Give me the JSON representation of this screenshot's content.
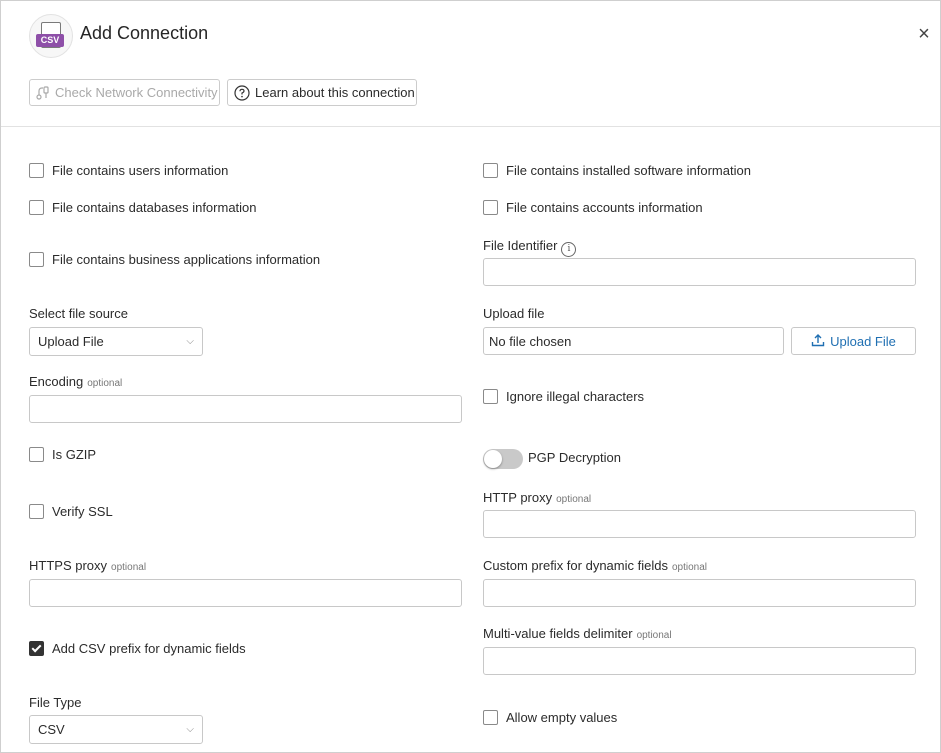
{
  "dialog": {
    "title": "Add Connection",
    "logo_text": "CSV",
    "close_glyph": "×"
  },
  "toolbar": {
    "check_network_label": "Check Network Connectivity",
    "learn_label": "Learn about this connection"
  },
  "checkboxes": {
    "users": {
      "label": "File contains users information",
      "checked": false
    },
    "databases": {
      "label": "File contains databases information",
      "checked": false
    },
    "business_apps": {
      "label": "File contains business applications information",
      "checked": false
    },
    "software": {
      "label": "File contains installed software information",
      "checked": false
    },
    "accounts": {
      "label": "File contains accounts information",
      "checked": false
    },
    "ignore_illegal": {
      "label": "Ignore illegal characters",
      "checked": false
    },
    "is_gzip": {
      "label": "Is GZIP",
      "checked": false
    },
    "verify_ssl": {
      "label": "Verify SSL",
      "checked": false
    },
    "csv_prefix": {
      "label": "Add CSV prefix for dynamic fields",
      "checked": true
    },
    "allow_empty": {
      "label": "Allow empty values",
      "checked": false
    }
  },
  "fields": {
    "file_identifier": {
      "label": "File Identifier",
      "value": ""
    },
    "file_source": {
      "label": "Select file source",
      "value": "Upload File"
    },
    "upload_file": {
      "label": "Upload file",
      "value": "No file chosen",
      "button_label": "Upload File"
    },
    "encoding": {
      "label": "Encoding",
      "optional": "optional",
      "value": ""
    },
    "pgp": {
      "label": "PGP Decryption",
      "on": false
    },
    "http_proxy": {
      "label": "HTTP proxy",
      "optional": "optional",
      "value": ""
    },
    "https_proxy": {
      "label": "HTTPS proxy",
      "optional": "optional",
      "value": ""
    },
    "custom_prefix": {
      "label": "Custom prefix for dynamic fields",
      "optional": "optional",
      "value": ""
    },
    "delimiter": {
      "label": "Multi-value fields delimiter",
      "optional": "optional",
      "value": ""
    },
    "file_type": {
      "label": "File Type",
      "value": "CSV"
    }
  },
  "icons": {
    "network": "network-plug-icon",
    "help": "question-circle-icon",
    "info": "info-icon",
    "upload": "upload-icon",
    "chevron": "chevron-down-icon"
  },
  "colors": {
    "accent": "#1f6fb2",
    "csv_tag": "#8e4fa8",
    "disabled_text": "#a9a9a9",
    "checked_box": "#333333"
  }
}
